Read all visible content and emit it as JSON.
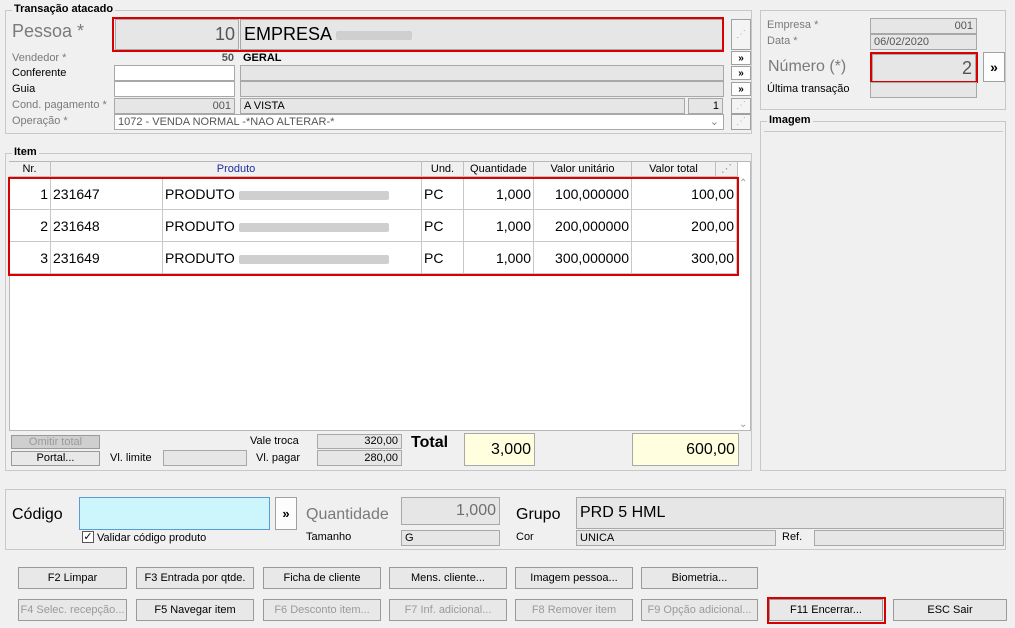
{
  "transacao": {
    "group_title": "Transação atacado",
    "pessoa_label": "Pessoa *",
    "pessoa_code": "10",
    "pessoa_name": "EMPRESA",
    "vendedor_label": "Vendedor *",
    "vendedor_code": "50",
    "vendedor_name": "GERAL",
    "conferente_label": "Conferente",
    "guia_label": "Guia",
    "cond_label": "Cond. pagamento *",
    "cond_code": "001",
    "cond_name": "A VISTA",
    "cond_parcelas": "1",
    "operacao_label": "Operação *",
    "operacao_value": "1072 - VENDA NORMAL -*NAO ALTERAR-*",
    "more_glyph": "»"
  },
  "side": {
    "empresa_label": "Empresa *",
    "empresa_value": "001",
    "data_label": "Data *",
    "data_value": "06/02/2020",
    "numero_label": "Número (*)",
    "numero_value": "2",
    "ultima_label": "Última transação",
    "imagem_title": "Imagem"
  },
  "item": {
    "group_title": "Item",
    "columns": [
      "Nr.",
      "Produto",
      "Und.",
      "Quantidade",
      "Valor unitário",
      "Valor total"
    ],
    "rows": [
      {
        "nr": "1",
        "codigo": "231647",
        "produto": "PRODUTO",
        "und": "PC",
        "qtd": "1,000",
        "unit": "100,000000",
        "total": "100,00"
      },
      {
        "nr": "2",
        "codigo": "231648",
        "produto": "PRODUTO",
        "und": "PC",
        "qtd": "1,000",
        "unit": "200,000000",
        "total": "200,00"
      },
      {
        "nr": "3",
        "codigo": "231649",
        "produto": "PRODUTO",
        "und": "PC",
        "qtd": "1,000",
        "unit": "300,000000",
        "total": "300,00"
      }
    ]
  },
  "totals": {
    "omitir_label": "Omitir total",
    "portal_label": "Portal...",
    "vl_limite_label": "Vl. limite",
    "vale_troca_label": "Vale troca",
    "vale_troca_value": "320,00",
    "vl_pagar_label": "Vl. pagar",
    "vl_pagar_value": "280,00",
    "total_label": "Total",
    "total_qtd": "3,000",
    "total_valor": "600,00"
  },
  "entry": {
    "codigo_label": "Código",
    "quantidade_label": "Quantidade",
    "quantidade_value": "1,000",
    "grupo_label": "Grupo",
    "grupo_value": "PRD 5 HML",
    "validar_label": "Validar código produto",
    "tamanho_label": "Tamanho",
    "tamanho_value": "G",
    "cor_label": "Cor",
    "cor_value": "UNICA",
    "ref_label": "Ref."
  },
  "buttons": {
    "f2": "F2 Limpar",
    "f3": "F3 Entrada por qtde.",
    "ficha": "Ficha de cliente",
    "mens": "Mens. cliente...",
    "imagem": "Imagem pessoa...",
    "biometria": "Biometria...",
    "f4": "F4 Selec. recepção...",
    "f5": "F5 Navegar item",
    "f6": "F6 Desconto item...",
    "f7": "F7 Inf. adicional...",
    "f8": "F8 Remover item",
    "f9": "F9 Opção adicional...",
    "f11": "F11 Encerrar...",
    "esc": "ESC Sair"
  }
}
